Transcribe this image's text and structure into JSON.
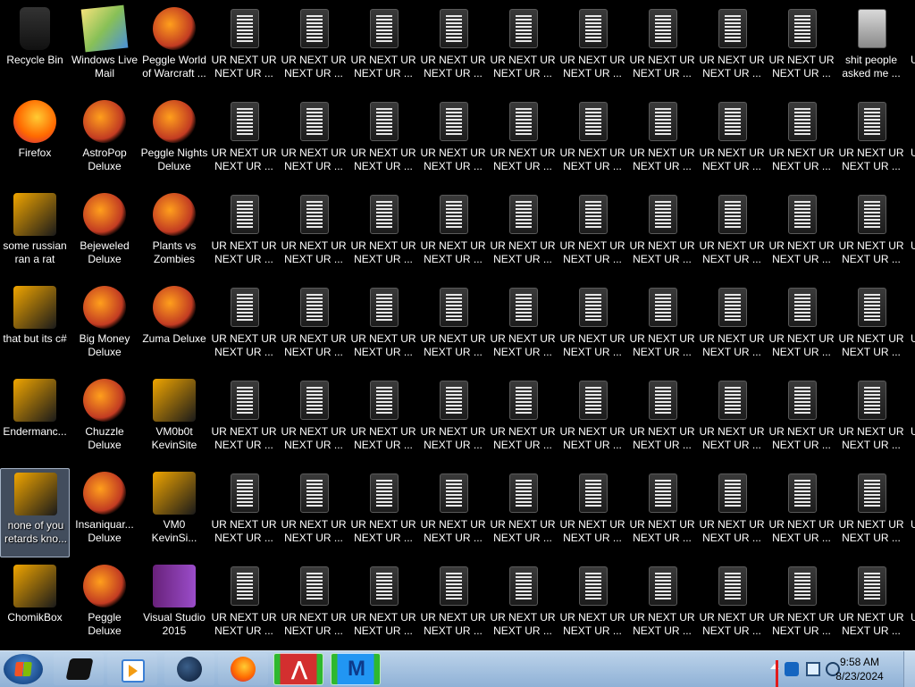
{
  "desktop": {
    "selected_label": "none of you retards kno...",
    "column_labels": [
      [
        "Recycle Bin",
        "Firefox",
        "some russian ran a rat",
        "that but its c#",
        "Endermanc...",
        "none of you retards kno...",
        "ChomikBox"
      ],
      [
        "Windows Live Mail",
        "AstroPop Deluxe",
        "Bejeweled Deluxe",
        "Big Money Deluxe",
        "Chuzzle Deluxe",
        "Insaniquar... Deluxe",
        "Peggle Deluxe"
      ],
      [
        "Peggle World of Warcraft ...",
        "Peggle Nights Deluxe",
        "Plants vs Zombies",
        "Zuma Deluxe",
        "VM0b0t KevinSite",
        "VM0 KevinSi...",
        "Visual Studio 2015"
      ]
    ],
    "repeated_file_label": "UR NEXT UR NEXT UR ...",
    "last_column_first_label": "shit people asked me ...",
    "partial_column_label": "U"
  },
  "taskbar": {
    "clock_time": "9:58 AM",
    "clock_date": "8/23/2024"
  },
  "colors": {
    "desktop_bg": "#000000",
    "taskbar_bg": "#a9c4e2"
  }
}
